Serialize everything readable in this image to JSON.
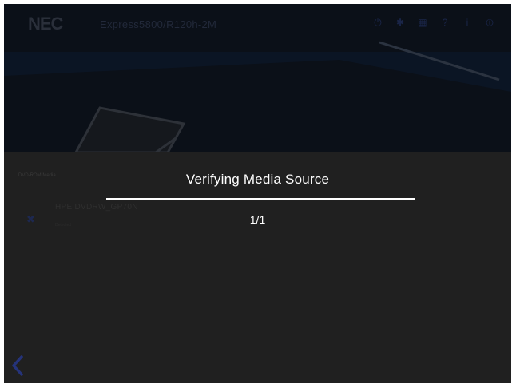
{
  "header": {
    "logo_text": "NEC",
    "model_text": "Express5800/R120h-2M",
    "toolbar_icons": [
      "power-icon",
      "settings-icon",
      "grid-icon",
      "help-icon",
      "info-icon",
      "shutdown-icon"
    ]
  },
  "panel": {
    "section_label": "DVD-ROM Media",
    "device_name": "HPE DVDRW_GP70N",
    "device_status": "Detected",
    "back_icon": "chevron-left-icon"
  },
  "dialog": {
    "title": "Verifying Media Source",
    "progress": 1.0,
    "count_text": "1/1"
  },
  "colors": {
    "background": "#202020",
    "header": "#0b1018",
    "text": "#ffffff",
    "accent_dim": "#1d2850"
  }
}
